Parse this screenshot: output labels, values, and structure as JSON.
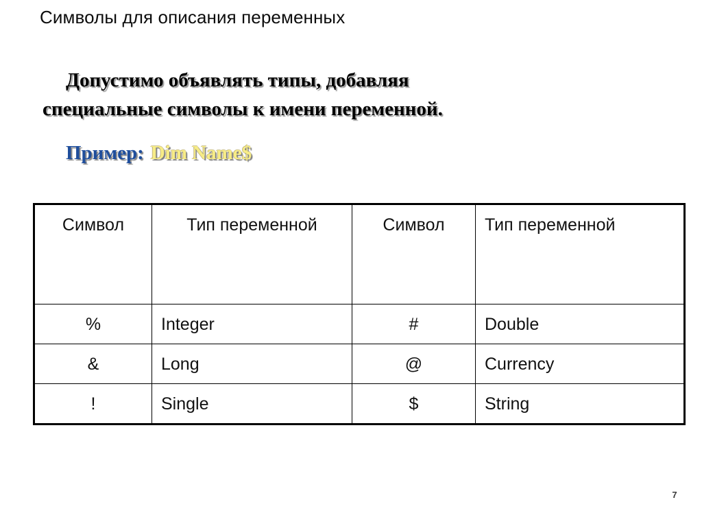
{
  "slide": {
    "title": "Символы для описания переменных",
    "page_number": "7"
  },
  "body": {
    "line1": "Допустимо объявлять типы, добавляя",
    "line2": "специальные символы к имени переменной."
  },
  "example": {
    "label": "Пример:",
    "code": "Dim Name$",
    "label_color": "#1F4E9C",
    "code_color": "#F7EC86"
  },
  "table": {
    "headers": [
      "Символ",
      "Тип переменной",
      "Символ",
      "Тип переменной"
    ],
    "rows": [
      {
        "symbol_left": "%",
        "type_left": "Integer",
        "symbol_right": "#",
        "type_right": "Double"
      },
      {
        "symbol_left": "&",
        "type_left": "Long",
        "symbol_right": "@",
        "type_right": "Currency"
      },
      {
        "symbol_left": "!",
        "type_left": "Single",
        "symbol_right": "$",
        "type_right": "String"
      }
    ]
  }
}
